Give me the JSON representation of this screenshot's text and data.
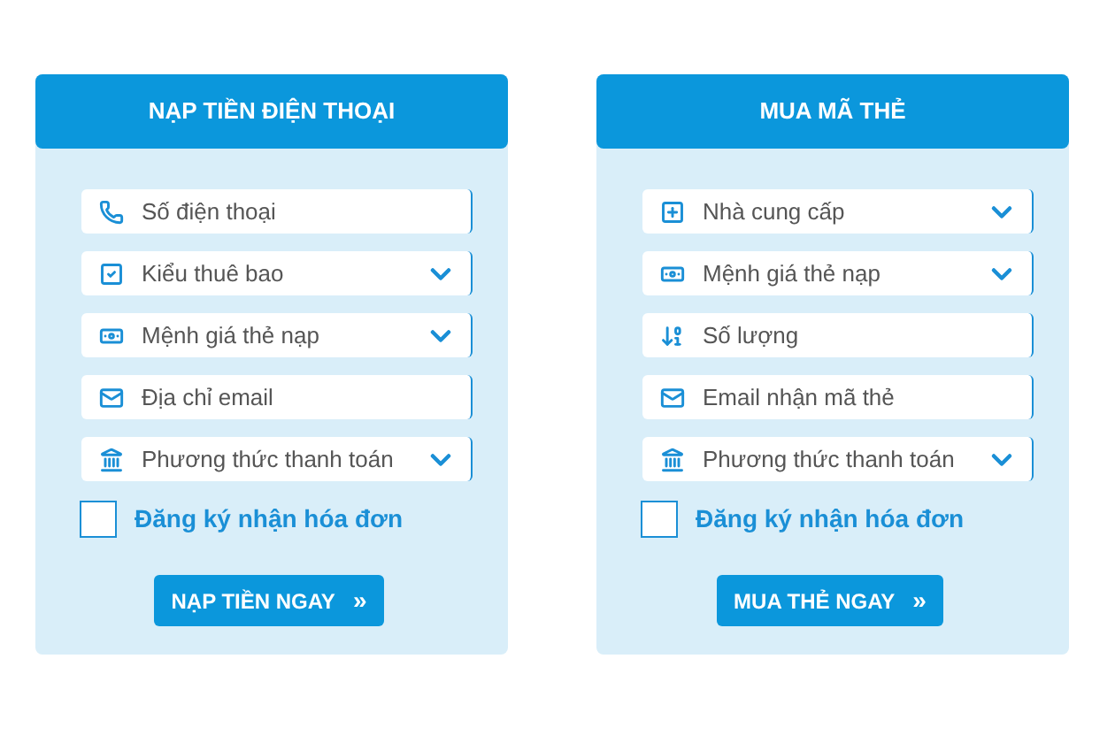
{
  "panels": [
    {
      "title": "NẠP TIỀN ĐIỆN THOẠI",
      "fields": [
        {
          "kind": "input",
          "placeholder": "Số điện thoại"
        },
        {
          "kind": "select",
          "label": "Kiểu thuê bao"
        },
        {
          "kind": "select",
          "label": "Mệnh giá thẻ nạp"
        },
        {
          "kind": "input",
          "placeholder": "Địa chỉ email"
        },
        {
          "kind": "select",
          "label": "Phương thức thanh toán"
        }
      ],
      "checkbox": {
        "label": "Đăng ký nhận hóa đơn",
        "checked": false
      },
      "button": {
        "label": "NẠP TIỀN NGAY",
        "icon": "»"
      }
    },
    {
      "title": "MUA MÃ THẺ",
      "fields": [
        {
          "kind": "select",
          "label": "Nhà cung cấp"
        },
        {
          "kind": "select",
          "label": "Mệnh giá thẻ nạp"
        },
        {
          "kind": "input",
          "placeholder": "Số lượng"
        },
        {
          "kind": "input",
          "placeholder": "Email nhận mã thẻ"
        },
        {
          "kind": "select",
          "label": "Phương thức thanh toán"
        }
      ],
      "checkbox": {
        "label": "Đăng ký nhận hóa đơn",
        "checked": false
      },
      "button": {
        "label": "MUA THẺ NGAY",
        "icon": "»"
      }
    }
  ]
}
